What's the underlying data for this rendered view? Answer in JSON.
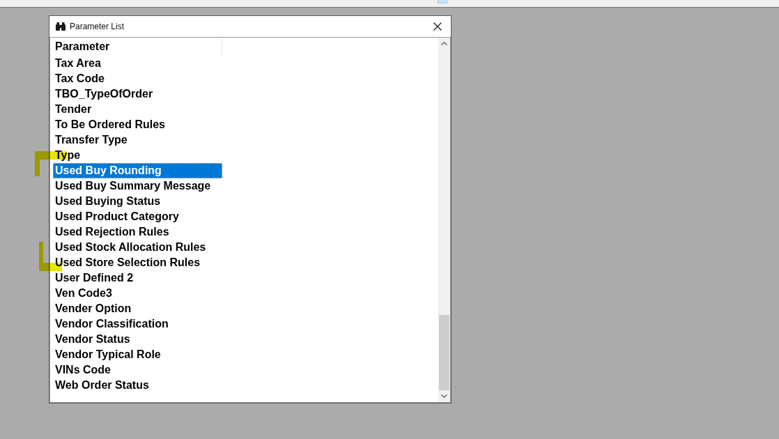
{
  "window": {
    "title": "Parameter List"
  },
  "list": {
    "header": "Parameter",
    "items": [
      {
        "label": "Tax Area",
        "selected": false
      },
      {
        "label": "Tax Code",
        "selected": false
      },
      {
        "label": "TBO_TypeOfOrder",
        "selected": false
      },
      {
        "label": "Tender",
        "selected": false
      },
      {
        "label": "To Be Ordered Rules",
        "selected": false
      },
      {
        "label": "Transfer Type",
        "selected": false
      },
      {
        "label": "Type",
        "selected": false
      },
      {
        "label": "Used Buy Rounding",
        "selected": true
      },
      {
        "label": "Used Buy Summary Message",
        "selected": false
      },
      {
        "label": "Used Buying Status",
        "selected": false
      },
      {
        "label": "Used Product Category",
        "selected": false
      },
      {
        "label": "Used Rejection Rules",
        "selected": false
      },
      {
        "label": "Used Stock Allocation Rules",
        "selected": false
      },
      {
        "label": "Used Store Selection Rules",
        "selected": false
      },
      {
        "label": "User Defined 2",
        "selected": false
      },
      {
        "label": "Ven Code3",
        "selected": false
      },
      {
        "label": "Vender Option",
        "selected": false
      },
      {
        "label": "Vendor Classification",
        "selected": false
      },
      {
        "label": "Vendor Status",
        "selected": false
      },
      {
        "label": "Vendor Typical Role",
        "selected": false
      },
      {
        "label": "VINs Code",
        "selected": false
      },
      {
        "label": "Web Order Status",
        "selected": false
      }
    ]
  }
}
